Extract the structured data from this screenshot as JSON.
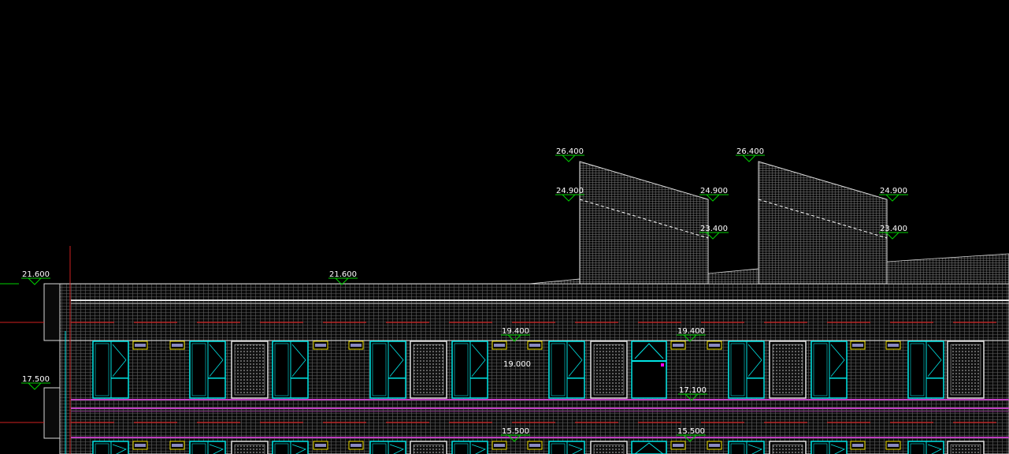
{
  "drawing": {
    "background": "#000000",
    "colors": {
      "wall_hatch": "#6b6b6b",
      "outline": "#d8d8d8",
      "window_frame": "#00e5e5",
      "vent": "#f0e000",
      "level_marker": "#00d000",
      "band_magenta": "#c040c0",
      "dash_red": "#d02020",
      "level_text": "#ffffff",
      "grip_magenta": "#ff00ff"
    },
    "levels": [
      {
        "id": "lvl-26400-a",
        "label": "26.400"
      },
      {
        "id": "lvl-26400-b",
        "label": "26.400"
      },
      {
        "id": "lvl-24900-a",
        "label": "24.900"
      },
      {
        "id": "lvl-24900-b",
        "label": "24.900"
      },
      {
        "id": "lvl-24900-c",
        "label": "24.900"
      },
      {
        "id": "lvl-24900-d",
        "label": "24.900"
      },
      {
        "id": "lvl-23400-a",
        "label": "23.400"
      },
      {
        "id": "lvl-23400-b",
        "label": "23.400"
      },
      {
        "id": "lvl-21600-a",
        "label": "21.600"
      },
      {
        "id": "lvl-21600-b",
        "label": "21.600"
      },
      {
        "id": "lvl-19400-a",
        "label": "19.400"
      },
      {
        "id": "lvl-19400-b",
        "label": "19.400"
      },
      {
        "id": "lvl-19000",
        "label": "19.000"
      },
      {
        "id": "lvl-17500",
        "label": "17.500"
      },
      {
        "id": "lvl-17100",
        "label": "17.100"
      },
      {
        "id": "lvl-15500-a",
        "label": "15.500"
      },
      {
        "id": "lvl-15500-b",
        "label": "15.500"
      }
    ]
  }
}
